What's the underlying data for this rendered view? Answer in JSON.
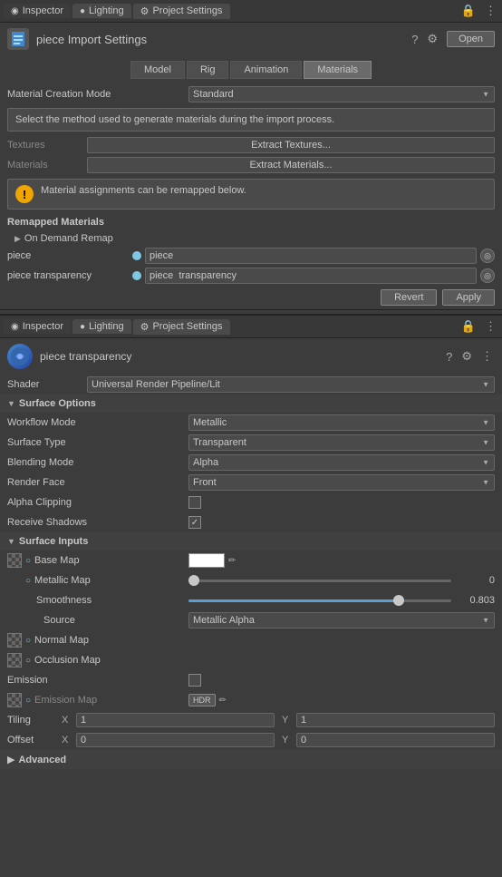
{
  "topPanel": {
    "tabs": [
      {
        "label": "Inspector",
        "icon": "◉",
        "active": true
      },
      {
        "label": "Lighting",
        "icon": "●"
      },
      {
        "label": "Project Settings",
        "icon": "⚙"
      }
    ],
    "fileTitle": "piece Import Settings",
    "openBtn": "Open",
    "subTabs": [
      {
        "label": "Model"
      },
      {
        "label": "Rig"
      },
      {
        "label": "Animation"
      },
      {
        "label": "Materials",
        "active": true
      }
    ],
    "materialCreationMode": {
      "label": "Material Creation Mode",
      "value": "Standard"
    },
    "tooltip": "Select the method used to generate materials during the import process.",
    "textures": {
      "label": "Textures",
      "btnExtract": "Extract Textures..."
    },
    "materials": {
      "label": "Materials",
      "btnExtract": "Extract Materials..."
    },
    "warning": "Material assignments can be remapped below.",
    "remappedMaterials": "Remapped Materials",
    "onDemandRemap": "On Demand Remap",
    "remapItems": [
      {
        "label": "piece",
        "value": "piece"
      },
      {
        "label": "piece transparency",
        "value": "piece  transparency"
      }
    ],
    "buttons": {
      "revert": "Revert",
      "apply": "Apply"
    }
  },
  "bottomPanel": {
    "tabs": [
      {
        "label": "Inspector",
        "icon": "◉",
        "active": true
      },
      {
        "label": "Lighting",
        "icon": "●"
      },
      {
        "label": "Project Settings",
        "icon": "⚙"
      }
    ],
    "assetName": "piece  transparency",
    "shader": {
      "label": "Shader",
      "value": "Universal Render Pipeline/Lit"
    },
    "surfaceOptions": {
      "title": "Surface Options",
      "workflowMode": {
        "label": "Workflow Mode",
        "value": "Metallic"
      },
      "surfaceType": {
        "label": "Surface Type",
        "value": "Transparent"
      },
      "blendingMode": {
        "label": "Blending Mode",
        "value": "Alpha"
      },
      "renderFace": {
        "label": "Render Face",
        "value": "Front"
      },
      "alphaClipping": {
        "label": "Alpha Clipping",
        "checked": false
      },
      "receiveShadows": {
        "label": "Receive Shadows",
        "checked": true
      }
    },
    "surfaceInputs": {
      "title": "Surface Inputs",
      "baseMap": {
        "label": "Base Map"
      },
      "metallicMap": {
        "label": "Metallic Map",
        "sliderValue": 0,
        "displayValue": "0"
      },
      "smoothness": {
        "label": "Smoothness",
        "sliderPercent": 80,
        "displayValue": "0.803"
      },
      "source": {
        "label": "Source",
        "value": "Metallic Alpha"
      },
      "normalMap": {
        "label": "Normal Map"
      },
      "occlusionMap": {
        "label": "Occlusion Map"
      },
      "emission": {
        "label": "Emission",
        "checked": false
      },
      "emissionMap": {
        "label": "Emission Map"
      },
      "tiling": {
        "label": "Tiling",
        "x": "1",
        "y": "1"
      },
      "offset": {
        "label": "Offset",
        "x": "0",
        "y": "0"
      }
    },
    "advanced": {
      "title": "Advanced"
    }
  }
}
